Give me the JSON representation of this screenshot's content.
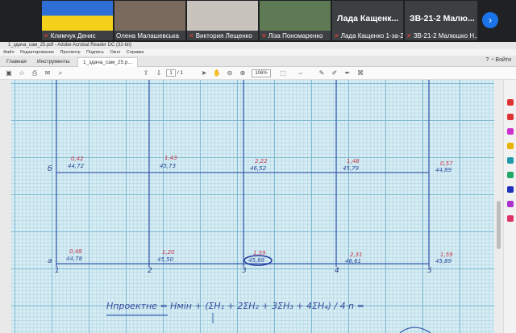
{
  "meet": {
    "participants": [
      {
        "name": "Климчук Денис"
      },
      {
        "name": "Олена Малашевська"
      },
      {
        "name": "Виктория Лещенко"
      },
      {
        "name": "Лiза Пономаренко"
      },
      {
        "name": "Лада Кащенко 1-за-2",
        "big": "Лада Кащенк..."
      },
      {
        "name": "ЗВ-21-2 Малюшко Н...",
        "big": "ЗВ-21-2 Малю..."
      }
    ],
    "next_icon": "chevron-right-icon"
  },
  "window": {
    "title": "1_здача_сам_25.pdf - Adobe Acrobat Reader DC (32-bit)",
    "menu": [
      "Файл",
      "Редактирование",
      "Просмотр",
      "Подпись",
      "Окно",
      "Справка"
    ],
    "tabs": [
      "Главная",
      "Инструменты",
      "1_здача_сам_25.p..."
    ],
    "signin": "Войти",
    "page_current": "1",
    "page_total": "/ 1",
    "zoom": "106%"
  },
  "drawing": {
    "row_b_label": "б",
    "row_a_label": "а",
    "col_labels": [
      "1",
      "2",
      "3",
      "4",
      "5"
    ],
    "row_b": [
      {
        "top": "0,42",
        "bottom": "44,72"
      },
      {
        "top": "1,43",
        "bottom": "45,73"
      },
      {
        "top": "2,22",
        "bottom": "46,52"
      },
      {
        "top": "1,48",
        "bottom": "45,79"
      },
      {
        "top": "0,57",
        "bottom": "44,89"
      }
    ],
    "row_a": [
      {
        "top": "0,48",
        "bottom": "44,78"
      },
      {
        "top": "1,20",
        "bottom": "45,50"
      },
      {
        "top": "1,59",
        "bottom": "45,89"
      },
      {
        "top": "2,31",
        "bottom": "46,61"
      },
      {
        "top": "1,59",
        "bottom": "45,89"
      }
    ],
    "formula": "Hпроектне = Hмін + (ΣH₁ + 2ΣH₂ + 3ΣH₃ + 4ΣH₄) / 4·n ="
  }
}
